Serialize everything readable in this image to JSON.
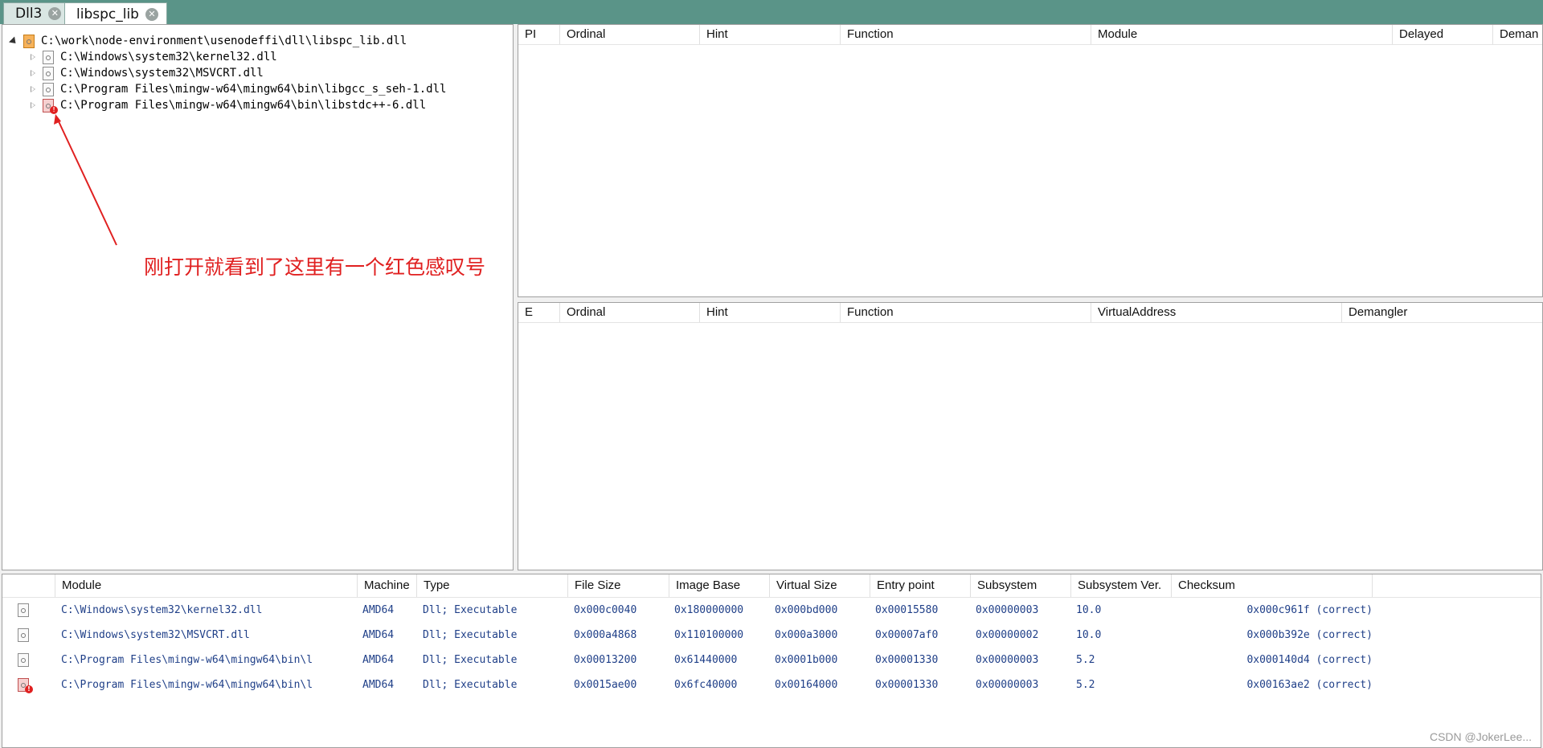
{
  "tabs": [
    {
      "label": "Dll3",
      "active": false
    },
    {
      "label": "libspc_lib",
      "active": true
    }
  ],
  "tree": {
    "root": "C:\\work\\node-environment\\usenodeffi\\dll\\libspc_lib.dll",
    "children": [
      {
        "label": "C:\\Windows\\system32\\kernel32.dll",
        "error": false
      },
      {
        "label": "C:\\Windows\\system32\\MSVCRT.dll",
        "error": false
      },
      {
        "label": "C:\\Program Files\\mingw-w64\\mingw64\\bin\\libgcc_s_seh-1.dll",
        "error": false
      },
      {
        "label": "C:\\Program Files\\mingw-w64\\mingw64\\bin\\libstdc++-6.dll",
        "error": true
      }
    ]
  },
  "annotation": {
    "text": "刚打开就看到了这里有一个红色感叹号",
    "color": "#e02020"
  },
  "imports_header": [
    "PI",
    "Ordinal",
    "Hint",
    "Function",
    "Module",
    "Delayed",
    "Deman"
  ],
  "exports_header": [
    "E",
    "Ordinal",
    "Hint",
    "Function",
    "VirtualAddress",
    "Demangler"
  ],
  "modules_header": [
    "Module",
    "Machine",
    "Type",
    "File Size",
    "Image Base",
    "Virtual Size",
    "Entry point",
    "Subsystem",
    "Subsystem Ver.",
    "Checksum"
  ],
  "modules": [
    {
      "module": "C:\\Windows\\system32\\kernel32.dll",
      "machine": "AMD64",
      "type": "Dll; Executable",
      "file_size": "0x000c0040",
      "image_base": "0x180000000",
      "virtual_size": "0x000bd000",
      "entry_point": "0x00015580",
      "subsystem": "0x00000003",
      "subsystem_ver": "10.0",
      "checksum": "0x000c961f (correct)",
      "error": false
    },
    {
      "module": "C:\\Windows\\system32\\MSVCRT.dll",
      "machine": "AMD64",
      "type": "Dll; Executable",
      "file_size": "0x000a4868",
      "image_base": "0x110100000",
      "virtual_size": "0x000a3000",
      "entry_point": "0x00007af0",
      "subsystem": "0x00000002",
      "subsystem_ver": "10.0",
      "checksum": "0x000b392e (correct)",
      "error": false
    },
    {
      "module": "C:\\Program Files\\mingw-w64\\mingw64\\bin\\l",
      "machine": "AMD64",
      "type": "Dll; Executable",
      "file_size": "0x00013200",
      "image_base": "0x61440000",
      "virtual_size": "0x0001b000",
      "entry_point": "0x00001330",
      "subsystem": "0x00000003",
      "subsystem_ver": "5.2",
      "checksum": "0x000140d4 (correct)",
      "error": false
    },
    {
      "module": "C:\\Program Files\\mingw-w64\\mingw64\\bin\\l",
      "machine": "AMD64",
      "type": "Dll; Executable",
      "file_size": "0x0015ae00",
      "image_base": "0x6fc40000",
      "virtual_size": "0x00164000",
      "entry_point": "0x00001330",
      "subsystem": "0x00000003",
      "subsystem_ver": "5.2",
      "checksum": "0x00163ae2 (correct)",
      "error": true
    }
  ],
  "watermark": "CSDN @JokerLee...",
  "colors": {
    "tabbar": "#5a9488",
    "cell_text": "#1f3f88",
    "error_red": "#e02020"
  }
}
